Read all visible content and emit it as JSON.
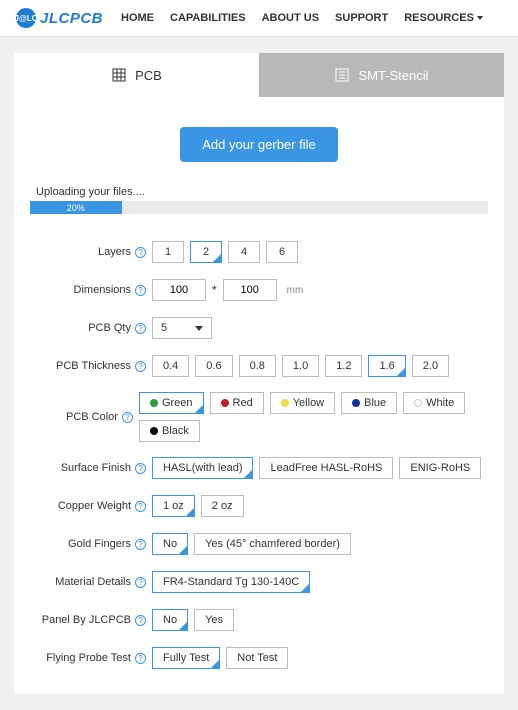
{
  "header": {
    "logo_text": "JLCPCB",
    "nav": [
      "HOME",
      "CAPABILITIES",
      "ABOUT US",
      "SUPPORT",
      "RESOURCES"
    ]
  },
  "tabs": {
    "pcb": "PCB",
    "stencil": "SMT-Stencil"
  },
  "upload": {
    "button": "Add your gerber file",
    "status": "Uploading your files....",
    "progress": "20%"
  },
  "labels": {
    "layers": "Layers",
    "dimensions": "Dimensions",
    "pcb_qty": "PCB Qty",
    "thickness": "PCB Thickness",
    "color": "PCB Color",
    "finish": "Surface Finish",
    "copper": "Copper Weight",
    "gold": "Gold Fingers",
    "material": "Material Details",
    "panel": "Panel By JLCPCB",
    "probe": "Flying Probe Test"
  },
  "layers": [
    "1",
    "2",
    "4",
    "6"
  ],
  "dimensions": {
    "w": "100",
    "h": "100",
    "unit": "mm"
  },
  "qty": "5",
  "thickness": [
    "0.4",
    "0.6",
    "0.8",
    "1.0",
    "1.2",
    "1.6",
    "2.0"
  ],
  "colors": [
    {
      "name": "Green",
      "hex": "#2a9d3a"
    },
    {
      "name": "Red",
      "hex": "#c02020"
    },
    {
      "name": "Yellow",
      "hex": "#e8e040"
    },
    {
      "name": "Blue",
      "hex": "#1030a0"
    },
    {
      "name": "White",
      "hex": "#ffffff"
    },
    {
      "name": "Black",
      "hex": "#000000"
    }
  ],
  "finish": [
    "HASL(with lead)",
    "LeadFree HASL-RoHS",
    "ENIG-RoHS"
  ],
  "copper": [
    "1 oz",
    "2 oz"
  ],
  "gold": [
    "No",
    "Yes (45° chamfered border)"
  ],
  "material": [
    "FR4-Standard Tg 130-140C"
  ],
  "panel": [
    "No",
    "Yes"
  ],
  "probe": [
    "Fully Test",
    "Not Test"
  ]
}
